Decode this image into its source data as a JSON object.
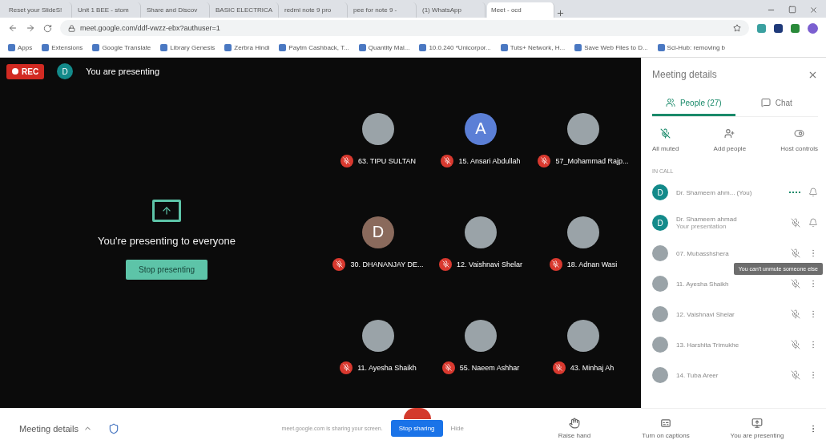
{
  "browser": {
    "tabs": [
      {
        "title": "Reset your SlideS!",
        "selected": false
      },
      {
        "title": "Unit 1 BEE - stom",
        "selected": false
      },
      {
        "title": "Share and Discov",
        "selected": false
      },
      {
        "title": "BASIC ELECTRICA",
        "selected": false
      },
      {
        "title": "redmi note 9 pro",
        "selected": false
      },
      {
        "title": "pee for note 9 -",
        "selected": false
      },
      {
        "title": "(1) WhatsApp",
        "selected": false
      },
      {
        "title": "Meet - ocd",
        "selected": true
      }
    ],
    "url": "meet.google.com/ddf-vwzz-ebx?authuser=1",
    "bookmarks": [
      "Apps",
      "Extensions",
      "Google Translate",
      "Library Genesis",
      "Zerbra Hindi",
      "Paytm Cashback, T...",
      "Quantity Mal...",
      "10.0.240 *Unicorpor...",
      "Tuts+ Network, H...",
      "Save Web Files to D...",
      "Sci-Hub: removing b"
    ]
  },
  "stage": {
    "rec": "REC",
    "presenter_initial": "D",
    "presenter_label": "You are presenting",
    "presenting_message": "You're presenting to everyone",
    "stop_presenting": "Stop presenting",
    "participants": [
      {
        "name": "63. TIPU SULTAN",
        "kind": "photo"
      },
      {
        "name": "15. Ansari Abdullah",
        "kind": "letter",
        "initial": "A",
        "color": "#5b7fd6"
      },
      {
        "name": "57_Mohammad Rajp...",
        "kind": "photo"
      },
      {
        "name": "30. DHANANJAY DE...",
        "kind": "letter",
        "initial": "D",
        "color": "#8a6a5c"
      },
      {
        "name": "12. Vaishnavi Shelar",
        "kind": "photo"
      },
      {
        "name": "18. Adnan Wasi",
        "kind": "photo"
      },
      {
        "name": "11. Ayesha Shaikh",
        "kind": "photo"
      },
      {
        "name": "55. Naeem Ashhar",
        "kind": "photo"
      },
      {
        "name": "43. Minhaj Ah",
        "kind": "photo"
      }
    ]
  },
  "panel": {
    "title": "Meeting details",
    "tabs": [
      {
        "label": "People (27)",
        "selected": true
      },
      {
        "label": "Chat",
        "selected": false
      }
    ],
    "actions": [
      {
        "label": "All muted",
        "kind": "mute"
      },
      {
        "label": "Add people",
        "kind": "add"
      },
      {
        "label": "Host controls",
        "kind": "toggle"
      }
    ],
    "section": "IN CALL",
    "people": [
      {
        "name": "Dr. Shameem ahm... (You)",
        "kind": "self",
        "initial": "D"
      },
      {
        "name": "Dr. Shameem ahmad",
        "subtitle": "Your presentation",
        "kind": "presentation",
        "initial": "D"
      },
      {
        "name": "07. Mubasshshera",
        "kind": "other"
      },
      {
        "name": "11. Ayesha Shaikh",
        "kind": "other"
      },
      {
        "name": "12. Vaishnavi Shelar",
        "kind": "other"
      },
      {
        "name": "13. Harshita Trimukhe",
        "kind": "other"
      },
      {
        "name": "14. Tuba Areer",
        "kind": "other"
      }
    ],
    "tooltip": "You can't unmute someone else"
  },
  "bottom": {
    "meeting_details": "Meeting details",
    "sharing_notice": "meet.google.com is sharing your screen.",
    "stop_sharing": "Stop sharing",
    "hide": "Hide",
    "actions": [
      {
        "label": "Raise hand",
        "kind": "hand"
      },
      {
        "label": "Turn on captions",
        "kind": "captions"
      },
      {
        "label": "You are presenting",
        "kind": "present"
      }
    ]
  }
}
